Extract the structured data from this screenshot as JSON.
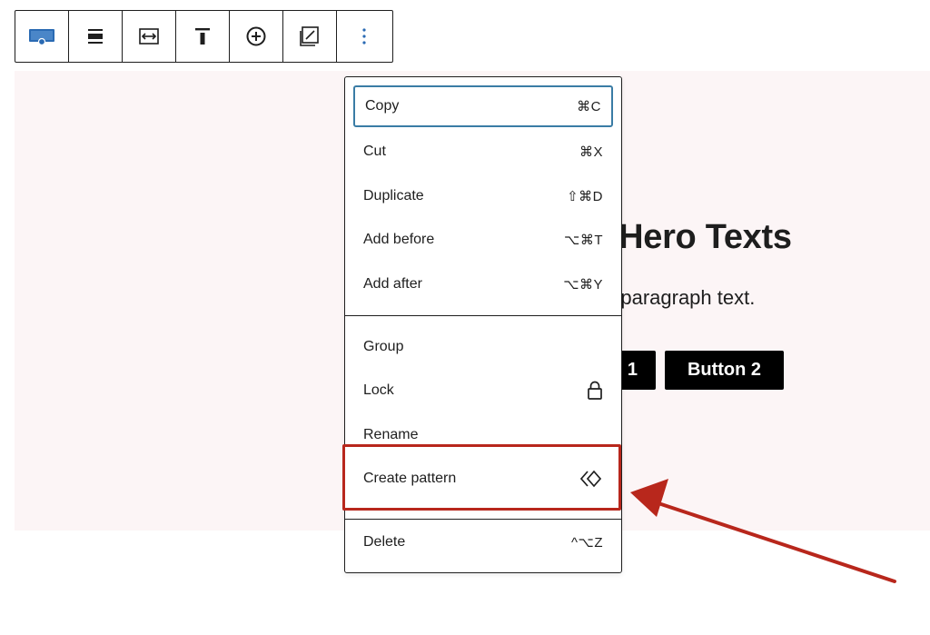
{
  "toolbar": {
    "buttons": [
      {
        "icon": "cover-block-icon"
      },
      {
        "icon": "align-icon"
      },
      {
        "icon": "width-icon"
      },
      {
        "icon": "vertical-align-top-icon"
      },
      {
        "icon": "add-icon"
      },
      {
        "icon": "fullscreen-toggle-icon"
      },
      {
        "icon": "more-options-icon"
      }
    ]
  },
  "cover": {
    "title": "e Hero Texts",
    "paragraph": "e paragraph text.",
    "button1": "1",
    "button2": "Button 2"
  },
  "menu": {
    "items": [
      {
        "label": "Copy",
        "shortcut": "⌘C"
      },
      {
        "label": "Cut",
        "shortcut": "⌘X"
      },
      {
        "label": "Duplicate",
        "shortcut": "⇧⌘D"
      },
      {
        "label": "Add before",
        "shortcut": "⌥⌘T"
      },
      {
        "label": "Add after",
        "shortcut": "⌥⌘Y"
      },
      {
        "label": "Group",
        "shortcut": ""
      },
      {
        "label": "Lock",
        "icon": "lock-icon"
      },
      {
        "label": "Rename",
        "shortcut": ""
      },
      {
        "label": "Create pattern",
        "icon": "pattern-icon"
      },
      {
        "label": "Delete",
        "shortcut": "^⌥Z"
      }
    ]
  },
  "colors": {
    "accent": "#3a7ca5",
    "highlight": "#b8271c",
    "cover_bg": "#fcf5f6",
    "brand_blue": "#2a6ab3"
  }
}
